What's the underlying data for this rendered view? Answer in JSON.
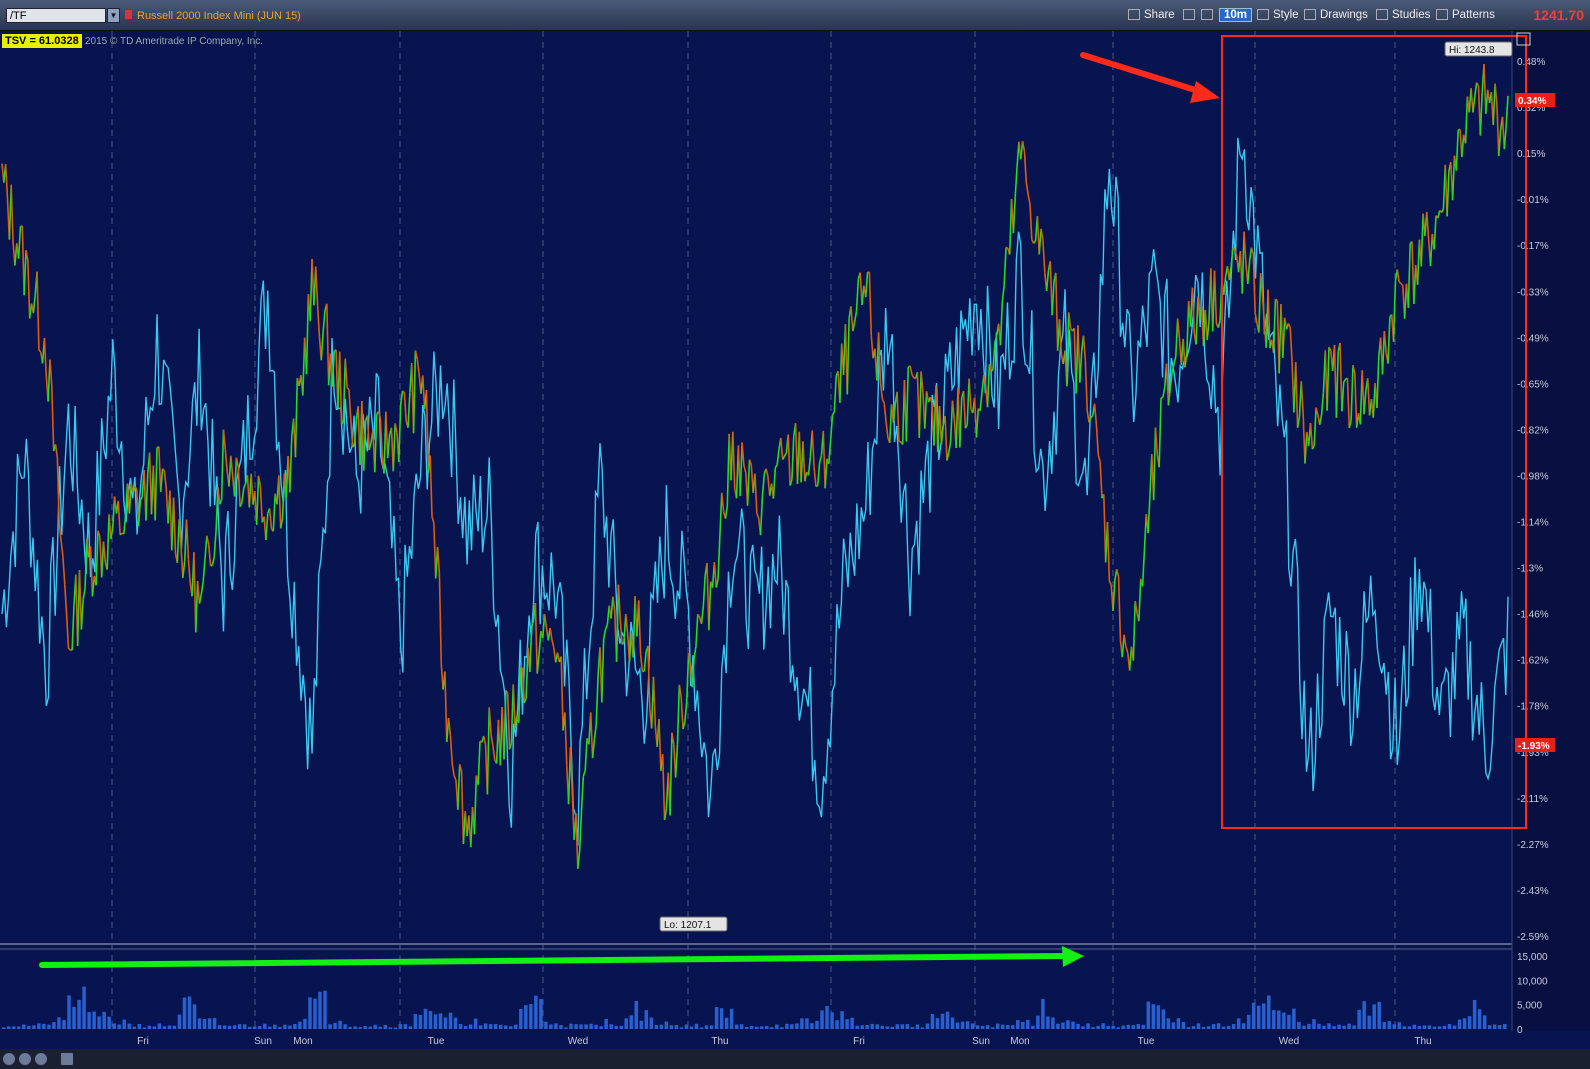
{
  "toolbar": {
    "symbol": "/TF",
    "title": "Russell 2000 Index Mini (JUN 15)",
    "share": "Share",
    "period": "10m",
    "style": "Style",
    "drawings": "Drawings",
    "studies": "Studies",
    "patterns": "Patterns",
    "last_price": "1241.70"
  },
  "indicator": {
    "badge": "TSV  = 61.0328",
    "copyright": "2015 © TD Ameritrade IP Company, Inc."
  },
  "colors": {
    "background": "#081450",
    "price_up": "#22dd22",
    "price_down": "#e05a10",
    "tsv_line": "#3ac8f0",
    "annotation_red": "#ff2a1a",
    "annotation_green": "#14f014",
    "volume": "#2860d0"
  },
  "chart_data": {
    "type": "line",
    "title": "Russell 2000 Index Mini (JUN 15)",
    "ylim": [
      "-2.59%",
      "0.34%"
    ],
    "y_ticks": [
      "0.48%",
      "0.32%",
      "0.15%",
      "-0.01%",
      "-0.17%",
      "-0.33%",
      "-0.49%",
      "-0.65%",
      "-0.82%",
      "-0.98%",
      "-1.14%",
      "-1.3%",
      "-1.46%",
      "-1.62%",
      "-1.78%",
      "-1.93%",
      "-2.11%",
      "-2.27%",
      "-2.43%",
      "-2.59%"
    ],
    "x_ticks": [
      "Fri",
      "Sun",
      "Mon",
      "Tue",
      "Wed",
      "Thu",
      "Fri",
      "Sun",
      "Mon",
      "Tue",
      "Wed",
      "Thu"
    ],
    "price_high_label": "Hi: 1243.8",
    "price_low_label": "Lo: 1207.1",
    "current_pct_label": "0.34%",
    "tsv_pct_label": "-1.93%",
    "volume_ticks": [
      "15,000",
      "10,000",
      "5,000",
      "0"
    ],
    "series": [
      {
        "name": "TSV",
        "values": [
          -1.5,
          -0.9,
          -1.7,
          -0.8,
          -1.3,
          -0.6,
          -1.2,
          -0.5,
          -1.1,
          -0.6,
          -1.4,
          -0.9,
          -0.3,
          -1.3,
          -2.0,
          -0.5,
          -1.0,
          -0.8,
          -1.6,
          -0.9,
          -0.6,
          -1.2,
          -1.1,
          -2.1,
          -1.3,
          -1.4,
          -2.2,
          -1.0,
          -1.6,
          -1.8,
          -1.2,
          -1.5,
          -2.2,
          -1.2,
          -1.5,
          -1.3,
          -1.7,
          -2.1,
          -1.4,
          -1.1,
          -0.4,
          -1.3,
          -0.9,
          -0.6,
          -0.3,
          -0.7,
          -0.2,
          -1.0,
          -0.5,
          -1.1,
          0.2,
          -0.7,
          -0.3,
          -0.6,
          -0.2,
          -0.8,
          0.3,
          -0.4,
          -1.0,
          -2.1,
          -1.5,
          -1.8,
          -1.4,
          -2.0,
          -1.3,
          -1.9,
          -1.6,
          -2.0,
          -1.6
        ]
      },
      {
        "name": "Price",
        "values": [
          0.1,
          -0.2,
          -0.5,
          -1.6,
          -1.3,
          -1.2,
          -1.1,
          -1.0,
          -1.2,
          -1.5,
          -0.9,
          -1.0,
          -1.1,
          -1.0,
          -0.3,
          -0.6,
          -0.8,
          -0.9,
          -0.8,
          -0.6,
          -1.8,
          -2.3,
          -2.0,
          -1.9,
          -1.6,
          -1.6,
          -2.4,
          -1.7,
          -1.5,
          -1.6,
          -2.2,
          -1.7,
          -1.4,
          -0.9,
          -1.1,
          -1.0,
          -0.9,
          -1.0,
          -0.6,
          -0.3,
          -0.8,
          -0.7,
          -0.8,
          -0.8,
          -0.7,
          -0.5,
          0.2,
          -0.2,
          -0.5,
          -0.6,
          -1.3,
          -1.7,
          -1.0,
          -0.5,
          -0.4,
          -0.3,
          -0.2,
          -0.4,
          -0.5,
          -0.9,
          -0.6,
          -0.7,
          -0.7,
          -0.3,
          -0.2,
          0.0,
          0.3,
          0.4,
          0.3
        ]
      }
    ],
    "volume": [
      1,
      1,
      2,
      8,
      3,
      2,
      1,
      1,
      6,
      2,
      1,
      1,
      1,
      2,
      7,
      3,
      1,
      1,
      1,
      6,
      3,
      2,
      1,
      1,
      7,
      2,
      1,
      1,
      2,
      5,
      2,
      1,
      1,
      4,
      1,
      1,
      1,
      2,
      5,
      2,
      1,
      1,
      1,
      4,
      2,
      1,
      1,
      2,
      6,
      2,
      1,
      1,
      1,
      5,
      2,
      1,
      1,
      3,
      7,
      4,
      2,
      1,
      1,
      5,
      2,
      1,
      1,
      2,
      5,
      1
    ]
  }
}
